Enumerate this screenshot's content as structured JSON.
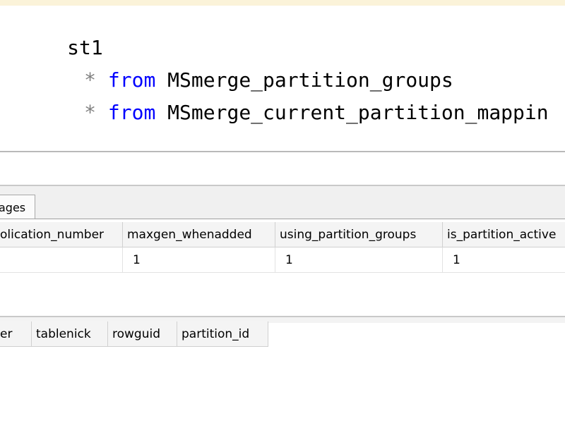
{
  "editor": {
    "lines": [
      {
        "text": "st1"
      },
      {
        "star": "*",
        "keyword": "from",
        "table": "MSmerge_partition_groups"
      },
      {
        "star": "*",
        "keyword": "from",
        "table": "MSmerge_current_partition_mappin"
      }
    ]
  },
  "results": {
    "tabs": [
      {
        "label": "ages"
      }
    ],
    "grid1": {
      "columns": [
        "olication_number",
        "maxgen_whenadded",
        "using_partition_groups",
        "is_partition_active"
      ],
      "rows": [
        [
          "",
          "1",
          "1",
          "1"
        ]
      ]
    },
    "grid2": {
      "columns": [
        "er",
        "tablenick",
        "rowguid",
        "partition_id"
      ]
    }
  },
  "colors": {
    "keyword": "#0000ff",
    "operator": "#808080",
    "editor_strip": "#fbf3d9"
  }
}
